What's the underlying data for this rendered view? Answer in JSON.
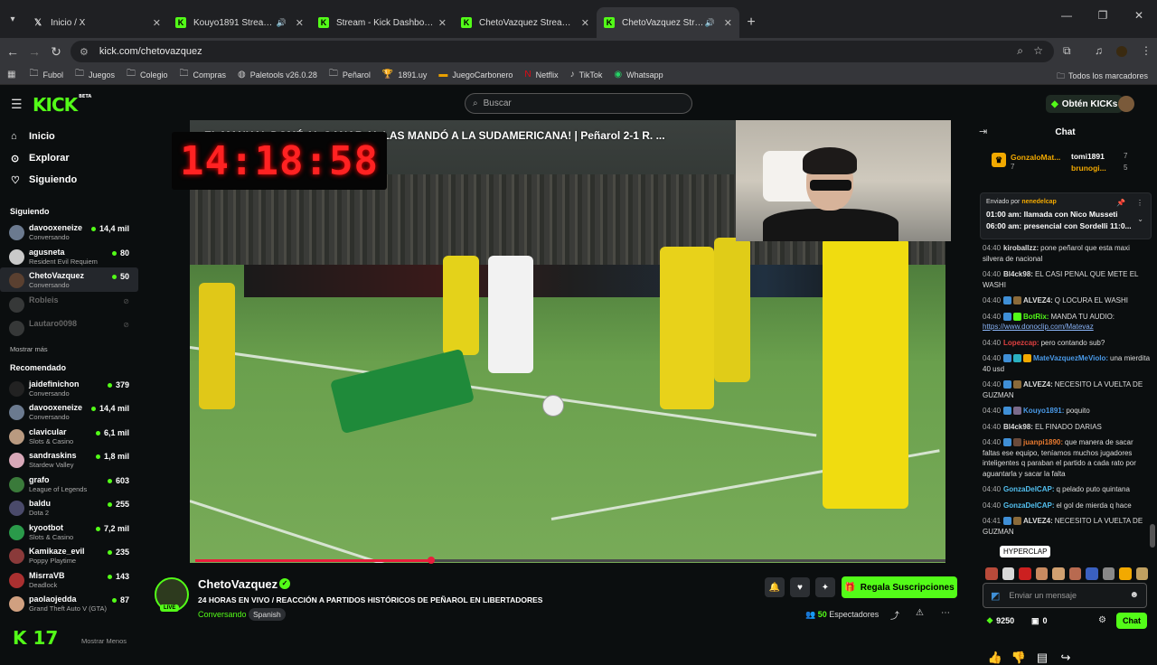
{
  "browser": {
    "tabs": [
      {
        "title": "Inicio / X",
        "icon": "x-logo-icon",
        "sound": ""
      },
      {
        "title": "Kouyo1891 Stream - Watch",
        "icon": "kick-icon",
        "sound": "🔊"
      },
      {
        "title": "Stream - Kick Dashboard",
        "icon": "kick-icon",
        "sound": ""
      },
      {
        "title": "ChetoVazquez Stream - Kick Da",
        "icon": "kick-icon",
        "sound": ""
      },
      {
        "title": "ChetoVazquez Stream - Wa",
        "icon": "kick-icon",
        "sound": "🔊"
      }
    ],
    "url": "kick.com/chetovazquez",
    "bookmarks": [
      {
        "label": "Fubol",
        "icon": "folder-icon"
      },
      {
        "label": "Juegos",
        "icon": "folder-icon"
      },
      {
        "label": "Colegio",
        "icon": "folder-icon"
      },
      {
        "label": "Compras",
        "icon": "folder-icon"
      },
      {
        "label": "Paletools v26.0.28",
        "icon": "globe-icon"
      },
      {
        "label": "Peñarol",
        "icon": "folder-icon"
      },
      {
        "label": "1891.uy",
        "icon": "trophy-icon"
      },
      {
        "label": "JuegoCarbonero",
        "icon": "game-icon"
      },
      {
        "label": "Netflix",
        "icon": "netflix-icon"
      },
      {
        "label": "TikTok",
        "icon": "tiktok-icon"
      },
      {
        "label": "Whatsapp",
        "icon": "whatsapp-icon"
      }
    ],
    "all_bookmarks": "Todos los marcadores"
  },
  "site": {
    "logo": "KICK",
    "logo_badge": "BETA",
    "search_placeholder": "Buscar",
    "get_kicks": "Obtén KICKs",
    "accent": "#53fc18"
  },
  "sidebar": {
    "nav": [
      {
        "label": "Inicio",
        "icon": "home-icon"
      },
      {
        "label": "Explorar",
        "icon": "compass-icon"
      },
      {
        "label": "Siguiendo",
        "icon": "heart-icon"
      }
    ],
    "following_title": "Siguiendo",
    "following": [
      {
        "name": "davooxeneize",
        "category": "Conversando",
        "viewers": "14,4 mil",
        "color": "#6b7a8f"
      },
      {
        "name": "agusneta",
        "category": "Resident Evil Requiem",
        "viewers": "80",
        "color": "#c9c9c9"
      },
      {
        "name": "ChetoVazquez",
        "category": "Conversando",
        "viewers": "50",
        "color": "#5a4030"
      },
      {
        "name": "Robleis",
        "category": "",
        "viewers": "",
        "color": "#888"
      },
      {
        "name": "Lautaro0098",
        "category": "",
        "viewers": "",
        "color": "#888"
      }
    ],
    "show_more": "Mostrar más",
    "recommended_title": "Recomendado",
    "recommended": [
      {
        "name": "jaidefinichon",
        "category": "Conversando",
        "viewers": "379",
        "color": "#222"
      },
      {
        "name": "davooxeneize",
        "category": "Conversando",
        "viewers": "14,4 mil",
        "color": "#6b7a8f"
      },
      {
        "name": "clavicular",
        "category": "Slots & Casino",
        "viewers": "6,1 mil",
        "color": "#b99a80"
      },
      {
        "name": "sandraskins",
        "category": "Stardew Valley",
        "viewers": "1,8 mil",
        "color": "#d8a8b8"
      },
      {
        "name": "grafo",
        "category": "League of Legends",
        "viewers": "603",
        "color": "#3a7a3a"
      },
      {
        "name": "baldu",
        "category": "Dota 2",
        "viewers": "255",
        "color": "#4a4a6a"
      },
      {
        "name": "kyootbot",
        "category": "Slots & Casino",
        "viewers": "7,2 mil",
        "color": "#2a9a4a"
      },
      {
        "name": "Kamikaze_evil",
        "category": "Poppy Playtime",
        "viewers": "235",
        "color": "#8a3a3a"
      },
      {
        "name": "MisrraVB",
        "category": "Deadlock",
        "viewers": "143",
        "color": "#aa3030"
      },
      {
        "name": "paolaojedda",
        "category": "Grand Theft Auto V (GTA)",
        "viewers": "87",
        "color": "#d0a080"
      }
    ],
    "footer_logo": "K 17",
    "show_less": "Mostrar Menos"
  },
  "video": {
    "overlay_title": "EL MANUAL DOMÉ AL GANAR AL LAS MANDÓ A LA SUDAMERICANA! | Peñarol 2-1 R. ...",
    "clock": "14:18:58",
    "progress_pct": 31.5
  },
  "stream": {
    "streamer": "ChetoVazquez",
    "live_badge": "LIVE",
    "title": "24 HORAS EN VIVO / REACCIÓN A PARTIDOS HISTÓRICOS DE PEÑAROL EN LIBERTADORES",
    "category": "Conversando",
    "language": "Spanish",
    "gift_button": "Regala Suscripciones",
    "viewers": "50",
    "viewers_label": "Espectadores"
  },
  "chat": {
    "title": "Chat",
    "leaderboard": [
      {
        "name": "GonzaloMat...",
        "value": "7",
        "color": "#f2a900"
      },
      {
        "name": "tomi1891",
        "value": "7",
        "color": "#fff"
      },
      {
        "name": "brunogi...",
        "value": "5",
        "color": "#f2a900"
      }
    ],
    "pinned": {
      "sent_by_label": "Enviado por",
      "sent_by": "nenedelcap",
      "line1": "01:00 am: llamada con Nico Musseti",
      "line2": "06:00 am: presencial con Sordelli 11:0..."
    },
    "messages": [
      {
        "time": "04:40",
        "user": "kiroballzz:",
        "color": "#ddd",
        "badges": [],
        "text": "pone peñarol que esta maxi silvera de nacional"
      },
      {
        "time": "04:40",
        "user": "Bl4ck98:",
        "color": "#ddd",
        "badges": [],
        "text": "EL CASI PENAL QUE METE EL WASHI"
      },
      {
        "time": "04:40",
        "user": "ALVEZ4:",
        "color": "#ddd",
        "badges": [
          "#3f8fd6",
          "#8a6a3a"
        ],
        "text": "Q LOCURA EL WASHI"
      },
      {
        "time": "04:40",
        "user": "BotRix:",
        "color": "#53fc18",
        "badges": [
          "#3f8fd6",
          "#53fc18"
        ],
        "text": "MANDA TU AUDIO:",
        "link": "https://www.donoclip.com/Matevaz"
      },
      {
        "time": "04:40",
        "user": "Lopezcap:",
        "color": "#e04040",
        "badges": [],
        "text": "pero contando sub?"
      },
      {
        "time": "04:40",
        "user": "MateVazquezMeViolo:",
        "color": "#4a9ae8",
        "badges": [
          "#3f8fd6",
          "#2ab0c0",
          "#f2a900"
        ],
        "text": "una mierdita 40 usd"
      },
      {
        "time": "04:40",
        "user": "ALVEZ4:",
        "color": "#ddd",
        "badges": [
          "#3f8fd6",
          "#8a6a3a"
        ],
        "text": "NECESITO LA VUELTA DE GUZMAN"
      },
      {
        "time": "04:40",
        "user": "Kouyo1891:",
        "color": "#4a9ae8",
        "badges": [
          "#3f8fd6",
          "#7a6a8a"
        ],
        "text": "poquito"
      },
      {
        "time": "04:40",
        "user": "Bl4ck98:",
        "color": "#ddd",
        "badges": [],
        "text": "EL FINADO DARIAS"
      },
      {
        "time": "04:40",
        "user": "juanpi1890:",
        "color": "#e87a30",
        "badges": [
          "#3f8fd6",
          "#6a4a3a"
        ],
        "text": "que manera de sacar faltas ese equipo, teníamos muchos jugadores inteligentes q paraban el partido a cada rato por aguantarla y sacar la falta"
      },
      {
        "time": "04:40",
        "user": "GonzaDelCAP:",
        "color": "#53c0f0",
        "badges": [],
        "text": "q pelado puto quintana"
      },
      {
        "time": "04:40",
        "user": "GonzaDelCAP:",
        "color": "#53c0f0",
        "badges": [],
        "text": "el gol de mierda q hace"
      },
      {
        "time": "04:41",
        "user": "ALVEZ4:",
        "color": "#ddd",
        "badges": [
          "#3f8fd6",
          "#8a6a3a"
        ],
        "text": "NECESITO LA VUELTA DE GUZMAN"
      }
    ],
    "emote_tooltip": "HYPERCLAP",
    "emotes": [
      "#b84a3a",
      "#d8d8d8",
      "#cc2020",
      "#c88a60",
      "#d0a070",
      "#b86a50",
      "#3a60c0",
      "#888",
      "#f2a900",
      "#c0a060"
    ],
    "input_placeholder": "Enviar un mensaje",
    "kick_points": "9250",
    "subs": "0",
    "chat_button": "Chat"
  }
}
